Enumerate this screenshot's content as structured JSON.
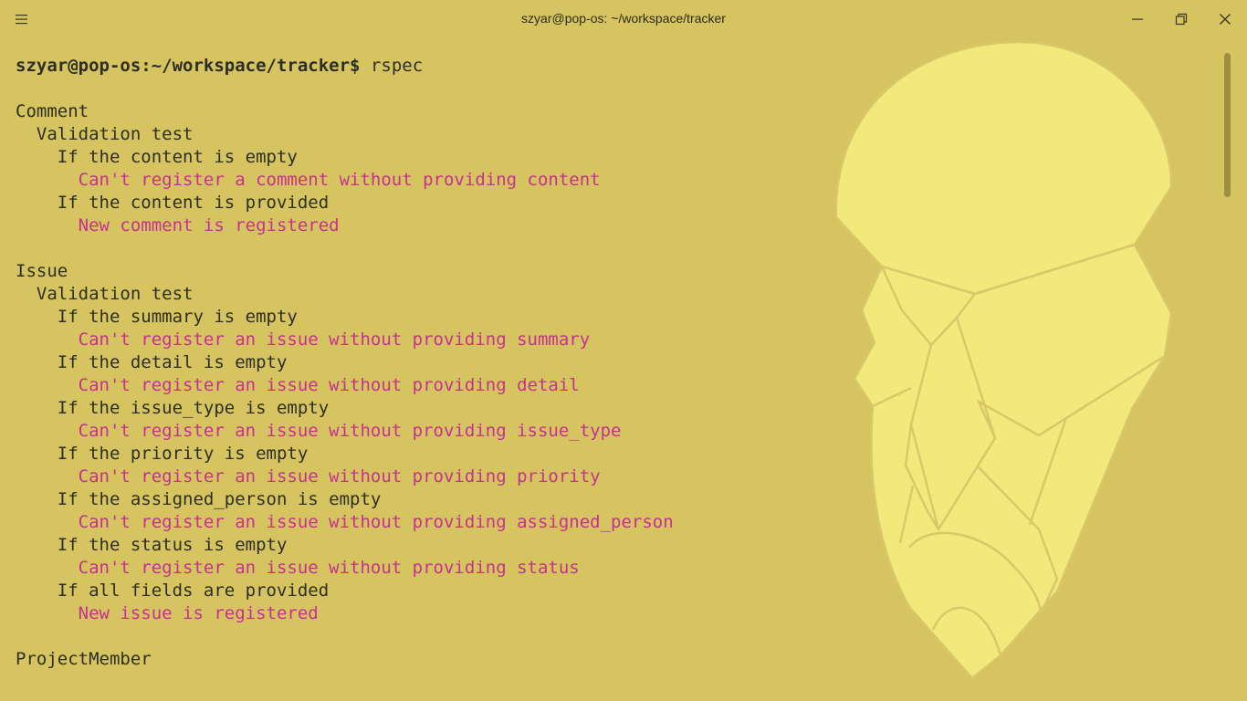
{
  "window": {
    "title": "szyar@pop-os: ~/workspace/tracker"
  },
  "colors": {
    "background": "#d6c461",
    "text": "#2e2d22",
    "pass": "#c6318f",
    "art_fill": "#f2e87c",
    "art_stroke": "#d8c868"
  },
  "icons": {
    "menu": "hamburger-icon",
    "minimize": "minimize-icon",
    "maximize": "restore-icon",
    "close": "close-icon"
  },
  "terminal": {
    "prompt": "szyar@pop-os:~/workspace/tracker$",
    "command": "rspec",
    "lines": [
      {
        "text": "",
        "type": "text"
      },
      {
        "text": "Comment",
        "type": "text"
      },
      {
        "text": "  Validation test",
        "type": "text"
      },
      {
        "text": "    If the content is empty",
        "type": "text"
      },
      {
        "text": "      Can't register a comment without providing content",
        "type": "pass"
      },
      {
        "text": "    If the content is provided",
        "type": "text"
      },
      {
        "text": "      New comment is registered",
        "type": "pass"
      },
      {
        "text": "",
        "type": "text"
      },
      {
        "text": "Issue",
        "type": "text"
      },
      {
        "text": "  Validation test",
        "type": "text"
      },
      {
        "text": "    If the summary is empty",
        "type": "text"
      },
      {
        "text": "      Can't register an issue without providing summary",
        "type": "pass"
      },
      {
        "text": "    If the detail is empty",
        "type": "text"
      },
      {
        "text": "      Can't register an issue without providing detail",
        "type": "pass"
      },
      {
        "text": "    If the issue_type is empty",
        "type": "text"
      },
      {
        "text": "      Can't register an issue without providing issue_type",
        "type": "pass"
      },
      {
        "text": "    If the priority is empty",
        "type": "text"
      },
      {
        "text": "      Can't register an issue without providing priority",
        "type": "pass"
      },
      {
        "text": "    If the assigned_person is empty",
        "type": "text"
      },
      {
        "text": "      Can't register an issue without providing assigned_person",
        "type": "pass"
      },
      {
        "text": "    If the status is empty",
        "type": "text"
      },
      {
        "text": "      Can't register an issue without providing status",
        "type": "pass"
      },
      {
        "text": "    If all fields are provided",
        "type": "text"
      },
      {
        "text": "      New issue is registered",
        "type": "pass"
      },
      {
        "text": "",
        "type": "text"
      },
      {
        "text": "ProjectMember",
        "type": "text"
      }
    ]
  }
}
